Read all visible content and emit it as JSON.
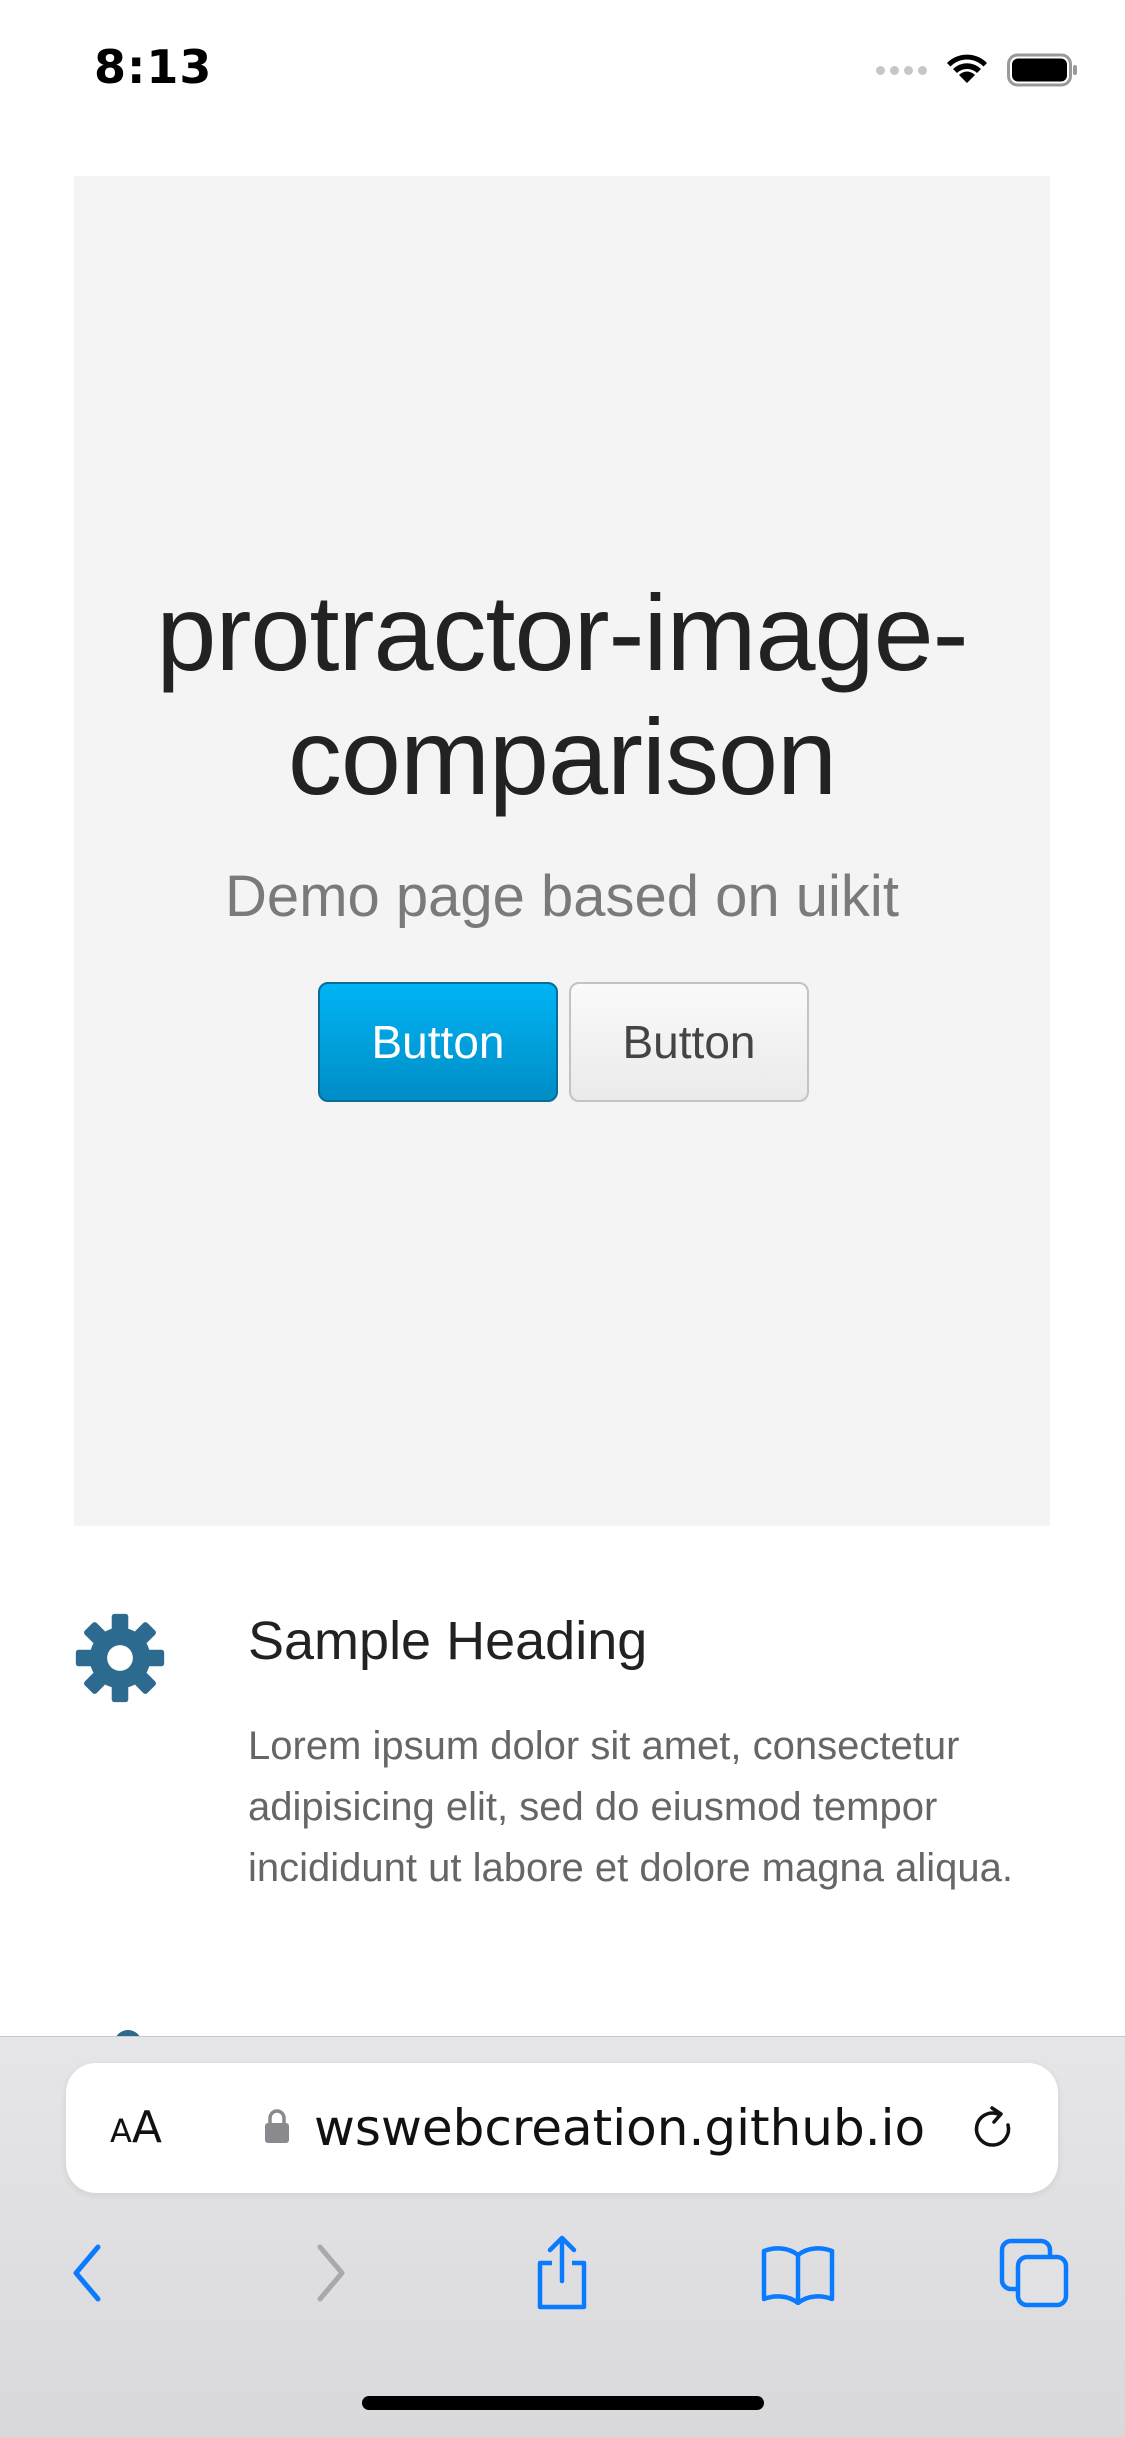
{
  "status_bar": {
    "time": "8:13"
  },
  "hero": {
    "title_line1": "protractor-image-",
    "title_line2": "comparison",
    "subtitle": "Demo page based on uikit",
    "primary_button_label": "Button",
    "default_button_label": "Button"
  },
  "feature": {
    "icon": "gear-icon",
    "heading": "Sample Heading",
    "text": "Lorem ipsum dolor sit amet, consectetur adipisicing elit, sed do eiusmod tempor incididunt ut labore et dolore magna aliqua."
  },
  "browser": {
    "aa_small": "A",
    "aa_large": "A",
    "url": "wswebcreation.github.io",
    "toolbar": [
      "back-icon",
      "forward-icon",
      "share-icon",
      "bookmarks-icon",
      "tabs-icon"
    ]
  },
  "colors": {
    "primary_button": "#00a8e6",
    "icon_blue": "#2d6a8f",
    "safari_blue": "#0a7aff",
    "hero_bg": "#f4f4f4"
  }
}
